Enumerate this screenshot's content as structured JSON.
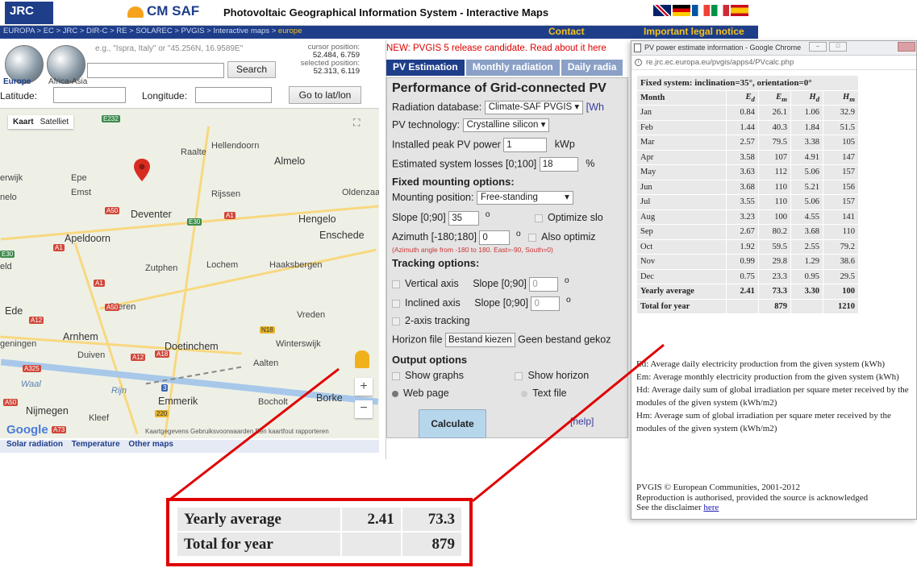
{
  "header": {
    "jrc_logo": "JRC",
    "cmsaf_logo": "CM SAF",
    "title": "Photovoltaic Geographical Information System - Interactive Maps",
    "breadcrumb": "EUROPA > EC > JRC > DIR-C > RE > SOLAREC > PVGIS > Interactive maps >",
    "breadcrumb_current": "europe",
    "contact": "Contact",
    "legal": "Important legal notice",
    "flags": [
      "#c8102e",
      "#000000",
      "#0055a4",
      "#009246",
      "#c60b1e"
    ]
  },
  "search": {
    "region_europe": "Europe",
    "region_africa": "Africa-Asia",
    "hint": "e.g., \"Ispra, Italy\" or \"45.256N, 16.9589E\"",
    "button": "Search",
    "cursor_label": "cursor position:",
    "cursor_value": "52.484, 6.759",
    "selected_label": "selected position:",
    "selected_value": "52.313, 6.119",
    "lat_label": "Latitude:",
    "lon_label": "Longitude:",
    "goto_button": "Go to lat/lon"
  },
  "map": {
    "type_map": "Kaart",
    "type_sat": "Satelliet",
    "cities": [
      "Raalte",
      "Hellendoorn",
      "Almelo",
      "Epe",
      "Emst",
      "Rijssen",
      "Oldenzaal",
      "Deventer",
      "Hengelo",
      "Enschede",
      "Apeldoorn",
      "Lochem",
      "Haaksbergen",
      "Zutphen",
      "Dieren",
      "Vreden",
      "Arnhem",
      "Doetinchem",
      "Winterswijk",
      "Duiven",
      "Aalten",
      "Emmerik",
      "Bocholt",
      "Borke",
      "Nijmegen",
      "Kleef",
      "Ede",
      "erwijk",
      "nelo",
      "eld",
      "geningen",
      "Waal",
      "Rijn"
    ],
    "shields": [
      "E232",
      "A50",
      "E30",
      "A1",
      "E30",
      "A50",
      "A12",
      "N18",
      "A12",
      "A18",
      "A325",
      "3",
      "A50",
      "220",
      "A73",
      "A1",
      "A1"
    ],
    "google": "Google",
    "footer": "Kaartgegevens   Gebruiksvoorwaarden   Een kaartfout rapporteren",
    "tabs": [
      "Solar radiation",
      "Temperature",
      "Other maps"
    ]
  },
  "pv": {
    "news": "NEW: PVGIS 5 release candidate. Read about it here",
    "tabs": [
      "PV Estimation",
      "Monthly radiation",
      "Daily radia"
    ],
    "form_title": "Performance of Grid-connected PV",
    "radiation_label": "Radiation database:",
    "radiation_value": "Climate-SAF PVGIS ▾",
    "radiation_link": "[Wh",
    "tech_label": "PV technology:",
    "tech_value": "Crystalline silicon ▾",
    "peak_label": "Installed peak PV power",
    "peak_value": "1",
    "peak_unit": "kWp",
    "losses_label": "Estimated system losses [0;100]",
    "losses_value": "18",
    "losses_unit": "%",
    "fixed_header": "Fixed mounting options:",
    "mount_label": "Mounting position:",
    "mount_value": "Free-standing",
    "slope_label": "Slope [0;90]",
    "slope_value": "35",
    "slope_unit": "o",
    "optimize_slope": "Optimize slo",
    "azimuth_label": "Azimuth [-180;180]",
    "azimuth_value": "0",
    "azimuth_unit": "o",
    "also_optimize": "Also optimiz",
    "azimuth_note": "(Azimuth angle from -180 to 180. East=-90, South=0)",
    "tracking_header": "Tracking options:",
    "vertical_axis": "Vertical axis",
    "inclined_axis": "Inclined axis",
    "two_axis": "2-axis tracking",
    "track_slope_label": "Slope [0;90]",
    "track_slope_value": "0",
    "o": "o",
    "horizon_label": "Horizon file",
    "horizon_button": "Bestand kiezen",
    "horizon_status": "Geen bestand gekoz",
    "output_header": "Output options",
    "show_graphs": "Show graphs",
    "show_horizon": "Show horizon",
    "web_page": "Web page",
    "text_file": "Text file",
    "calculate": "Calculate",
    "help": "[help]"
  },
  "popup": {
    "window_title": "PV power estimate information - Google Chrome",
    "url": "re.jrc.ec.europa.eu/pvgis/apps4/PVcalc.php",
    "caption": "Fixed system: inclination=35°, orientation=0°",
    "columns": [
      "Month",
      "Ed",
      "Em",
      "Hd",
      "Hm"
    ],
    "rows": [
      [
        "Jan",
        "0.84",
        "26.1",
        "1.06",
        "32.9"
      ],
      [
        "Feb",
        "1.44",
        "40.3",
        "1.84",
        "51.5"
      ],
      [
        "Mar",
        "2.57",
        "79.5",
        "3.38",
        "105"
      ],
      [
        "Apr",
        "3.58",
        "107",
        "4.91",
        "147"
      ],
      [
        "May",
        "3.63",
        "112",
        "5.06",
        "157"
      ],
      [
        "Jun",
        "3.68",
        "110",
        "5.21",
        "156"
      ],
      [
        "Jul",
        "3.55",
        "110",
        "5.06",
        "157"
      ],
      [
        "Aug",
        "3.23",
        "100",
        "4.55",
        "141"
      ],
      [
        "Sep",
        "2.67",
        "80.2",
        "3.68",
        "110"
      ],
      [
        "Oct",
        "1.92",
        "59.5",
        "2.55",
        "79.2"
      ],
      [
        "Nov",
        "0.99",
        "29.8",
        "1.29",
        "38.6"
      ],
      [
        "Dec",
        "0.75",
        "23.3",
        "0.95",
        "29.5"
      ]
    ],
    "yearly_average": [
      "Yearly average",
      "2.41",
      "73.3",
      "3.30",
      "100"
    ],
    "total_year": [
      "Total for year",
      "",
      "879",
      "",
      "1210"
    ],
    "legend": [
      "Ed: Average daily electricity production from the given system (kWh)",
      "Em: Average monthly electricity production from the given system (kWh)",
      "Hd: Average daily sum of global irradiation per square meter received by the modules of the given system (kWh/m2)",
      "Hm: Average sum of global irradiation per square meter received by the modules of the given system (kWh/m2)"
    ],
    "footer_line1": "PVGIS © European Communities, 2001-2012",
    "footer_line2": "Reproduction is authorised, provided the source is acknowledged",
    "footer_line3": "See the disclaimer",
    "footer_link": "here"
  },
  "zoom": {
    "row1": [
      "Yearly average",
      "2.41",
      "73.3"
    ],
    "row2": [
      "Total for year",
      "",
      "879"
    ],
    "highlight_color": "#e00000"
  }
}
